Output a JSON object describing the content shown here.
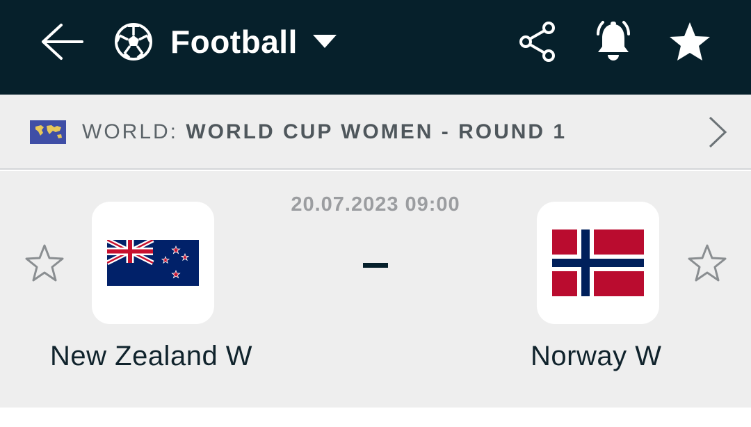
{
  "header": {
    "sport_label": "Football",
    "icons": [
      "back-arrow-icon",
      "football-icon",
      "caret-down-icon",
      "share-icon",
      "bell-ringing-icon",
      "star-filled-icon"
    ],
    "background_color": "#06202b"
  },
  "league": {
    "country": "WORLD: ",
    "competition": "WORLD CUP WOMEN - ROUND 1",
    "icons": [
      "world-flag-icon",
      "chevron-right-icon"
    ]
  },
  "match": {
    "datetime": "20.07.2023 09:00",
    "score_separator": "-",
    "home_team": {
      "name": "New Zealand W",
      "flag": "new-zealand-flag"
    },
    "away_team": {
      "name": "Norway W",
      "flag": "norway-flag"
    }
  }
}
